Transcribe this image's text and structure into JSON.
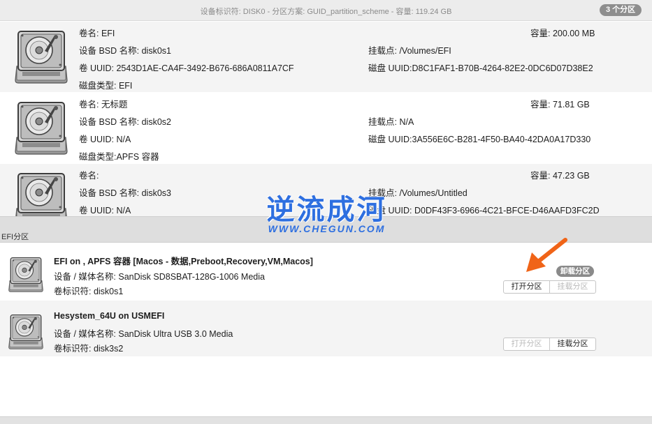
{
  "header": {
    "disk_info": "设备标识符: DISK0 - 分区方案: GUID_partition_scheme - 容量: 119.24 GB",
    "partition_count": "3 个分区"
  },
  "partitions": [
    {
      "volume_name": "卷名: EFI",
      "capacity": "容量:  200.00 MB",
      "bsd_name": "设备 BSD 名称: disk0s1",
      "mount_point": "挂载点: /Volumes/EFI",
      "volume_uuid": "卷 UUID: 2543D1AE-CA4F-3492-B676-686A0811A7CF",
      "disk_uuid": "磁盘 UUID:D8C1FAF1-B70B-4264-82E2-0DC6D07D38E2",
      "disk_type": "磁盘类型: EFI"
    },
    {
      "volume_name": "卷名: 无标题",
      "capacity": "容量:  71.81 GB",
      "bsd_name": "设备 BSD 名称: disk0s2",
      "mount_point": "挂载点: N/A",
      "volume_uuid": "卷 UUID: N/A",
      "disk_uuid": "磁盘 UUID:3A556E6C-B281-4F50-BA40-42DA0A17D330",
      "disk_type": "磁盘类型:APFS 容器"
    },
    {
      "volume_name": "卷名:",
      "capacity": "容量:  47.23 GB",
      "bsd_name": "设备 BSD 名称: disk0s3",
      "mount_point": "挂载点: /Volumes/Untitled",
      "volume_uuid": "卷 UUID: N/A",
      "disk_uuid": "磁盘 UUID: D0DF43F3-6966-4C21-BFCE-D46AAFD3FC2D"
    }
  ],
  "efi_section": {
    "label": "EFI分区",
    "items": [
      {
        "title": "EFI on , APFS 容器 [Macos - 数据,Preboot,Recovery,VM,Macos]",
        "media": "设备 / 媒体名称: SanDisk SD8SBAT-128G-1006 Media",
        "identifier": "卷标识符: disk0s1",
        "open_label": "打开分区",
        "mount_label": "挂载分区",
        "badge": "卸载分区"
      },
      {
        "title": "Hesystem_64U on USMEFI",
        "media": "设备 / 媒体名称: SanDisk Ultra USB 3.0 Media",
        "identifier": "卷标识符: disk3s2",
        "open_label": "打开分区",
        "mount_label": "挂载分区"
      }
    ]
  },
  "watermark": {
    "title": "逆流成河",
    "url": "WWW.CHEGUN.COM"
  },
  "colors": {
    "watermark_blue": "#2e6fe0",
    "arrow_orange": "#f06418",
    "badge_gray": "#8e8e8e"
  }
}
